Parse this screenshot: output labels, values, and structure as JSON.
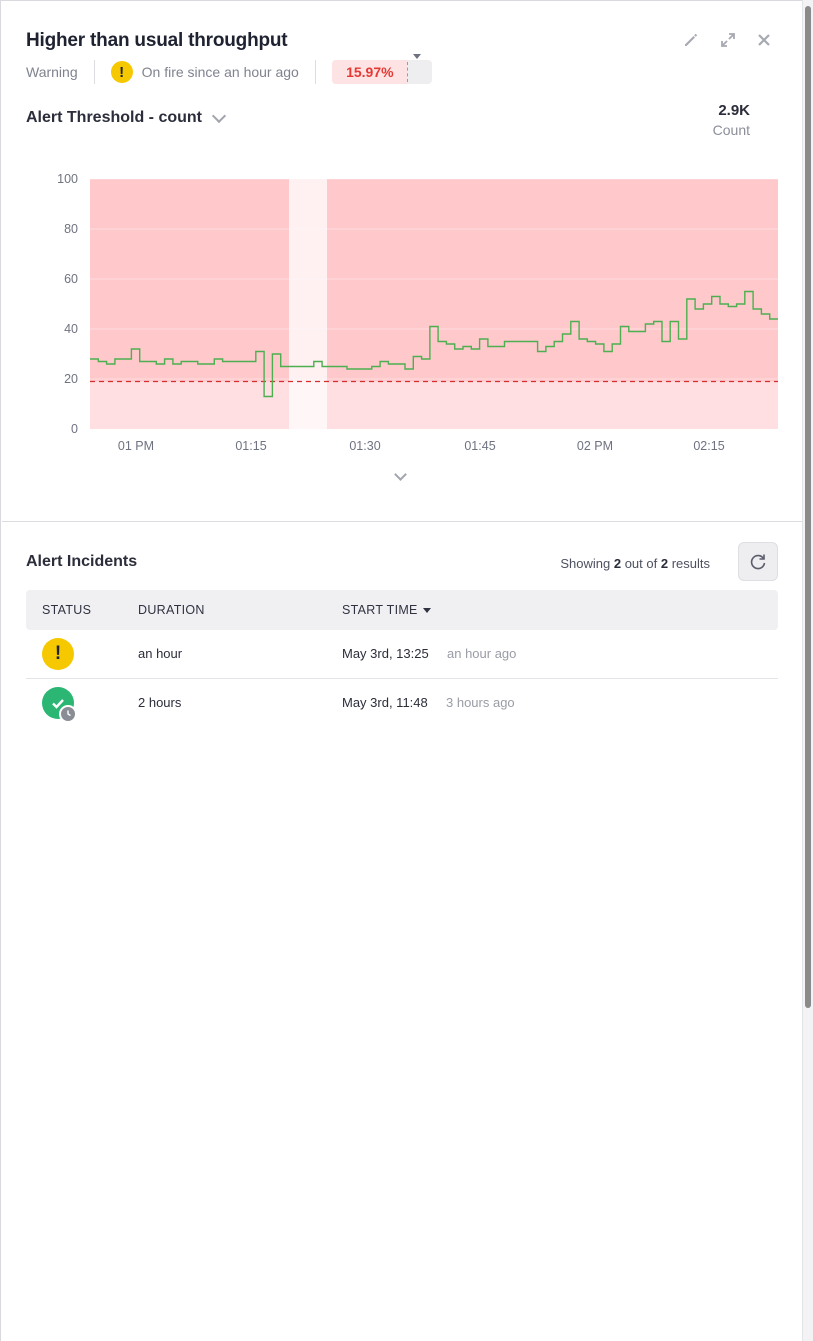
{
  "header": {
    "title": "Higher than usual throughput",
    "severity": "Warning",
    "status_text": "On fire since an hour ago",
    "percent": "15.97%",
    "actions": [
      {
        "name": "edit-icon",
        "label": "✎"
      },
      {
        "name": "expand-icon",
        "label": "⤢"
      },
      {
        "name": "close-icon",
        "label": "✕"
      }
    ]
  },
  "metric": {
    "selected": "Alert Threshold - count",
    "big_value": "2.9K",
    "big_label": "Count"
  },
  "chart_data": {
    "type": "line",
    "y_ticks": [
      "100",
      "80",
      "60",
      "40",
      "20",
      "0"
    ],
    "x_ticks": [
      "01 PM",
      "01:15",
      "01:30",
      "01:45",
      "02 PM",
      "02:15"
    ],
    "ylim": [
      0,
      100
    ],
    "threshold": 19,
    "series": [
      {
        "values": [
          28,
          27,
          26,
          28,
          28,
          32,
          27,
          27,
          26,
          28,
          26,
          27,
          27,
          26,
          26,
          28,
          27,
          27,
          27,
          27,
          31,
          13,
          30,
          25,
          25,
          25,
          25,
          27,
          25,
          25,
          25,
          24,
          24,
          24,
          25,
          27,
          26,
          26,
          24,
          29,
          28,
          41,
          35,
          34,
          32,
          33,
          32,
          36,
          33,
          33,
          35,
          35,
          35,
          35,
          31,
          33,
          35,
          38,
          43,
          36,
          35,
          34,
          31,
          34,
          41,
          39,
          39,
          42,
          43,
          35,
          43,
          36,
          52,
          48,
          50,
          53,
          50,
          49,
          50,
          55,
          48,
          46,
          44
        ]
      }
    ],
    "colors": {
      "line": "#4caf50",
      "threshold": "#d32f2f",
      "critical_band": "#ffc9cc",
      "critical_fill": "#ffdfe1"
    }
  },
  "incidents": {
    "title": "Alert Incidents",
    "showing_prefix": "Showing",
    "shown": "2",
    "of_text": "out of",
    "total": "2",
    "results_text": "results",
    "columns": [
      "STATUS",
      "DURATION",
      "START TIME"
    ],
    "rows": [
      {
        "status": "warning",
        "duration": "an hour",
        "start": "May 3rd, 13:25",
        "relative": "an hour ago"
      },
      {
        "status": "resolved",
        "duration": "2 hours",
        "start": "May 3rd, 11:48",
        "relative": "3 hours ago"
      }
    ]
  }
}
